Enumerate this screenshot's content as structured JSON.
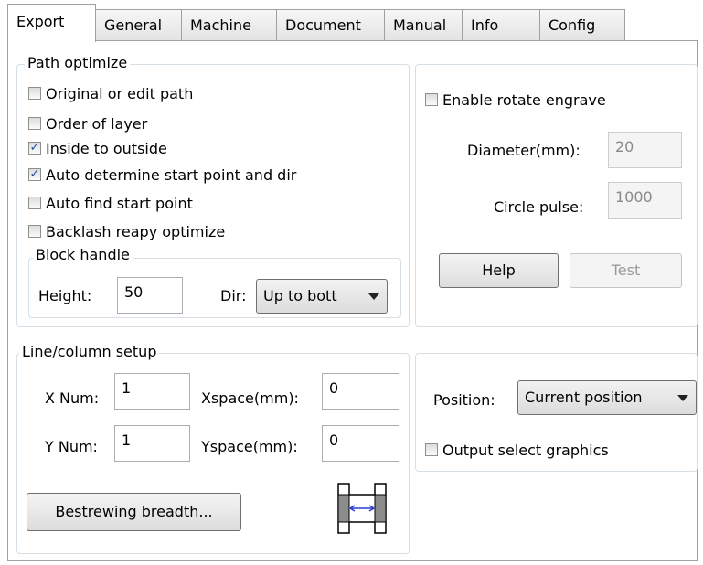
{
  "tabs": [
    {
      "label": "Export",
      "active": true
    },
    {
      "label": "General"
    },
    {
      "label": "Machine"
    },
    {
      "label": "Document"
    },
    {
      "label": "Manual"
    },
    {
      "label": "Info"
    },
    {
      "label": "Config"
    }
  ],
  "path_optimize": {
    "title": "Path optimize",
    "options": [
      {
        "label": "Original or edit path",
        "checked": false
      },
      {
        "label": "Order of layer",
        "checked": false
      },
      {
        "label": "Inside to outside",
        "checked": true
      },
      {
        "label": "Auto determine start point and dir",
        "checked": true
      },
      {
        "label": "Auto find start point",
        "checked": false
      },
      {
        "label": "Backlash reapy optimize",
        "checked": false
      }
    ],
    "block_handle": {
      "title": "Block handle",
      "height_label": "Height:",
      "height_value": "50",
      "dir_label": "Dir:",
      "dir_value": "Up to bott"
    }
  },
  "rotate": {
    "enable_label": "Enable rotate engrave",
    "enable_checked": false,
    "diameter_label": "Diameter(mm):",
    "diameter_value": "20",
    "pulse_label": "Circle pulse:",
    "pulse_value": "1000",
    "help_label": "Help",
    "test_label": "Test"
  },
  "line_column": {
    "title": "Line/column setup",
    "xnum_label": "X Num:",
    "xnum_value": "1",
    "xspace_label": "Xspace(mm):",
    "xspace_value": "0",
    "ynum_label": "Y Num:",
    "ynum_value": "1",
    "yspace_label": "Yspace(mm):",
    "yspace_value": "0",
    "bestrewing_label": "Bestrewing breadth..."
  },
  "output": {
    "position_label": "Position:",
    "position_value": "Current position",
    "select_graphics_label": "Output select graphics",
    "select_graphics_checked": false
  }
}
